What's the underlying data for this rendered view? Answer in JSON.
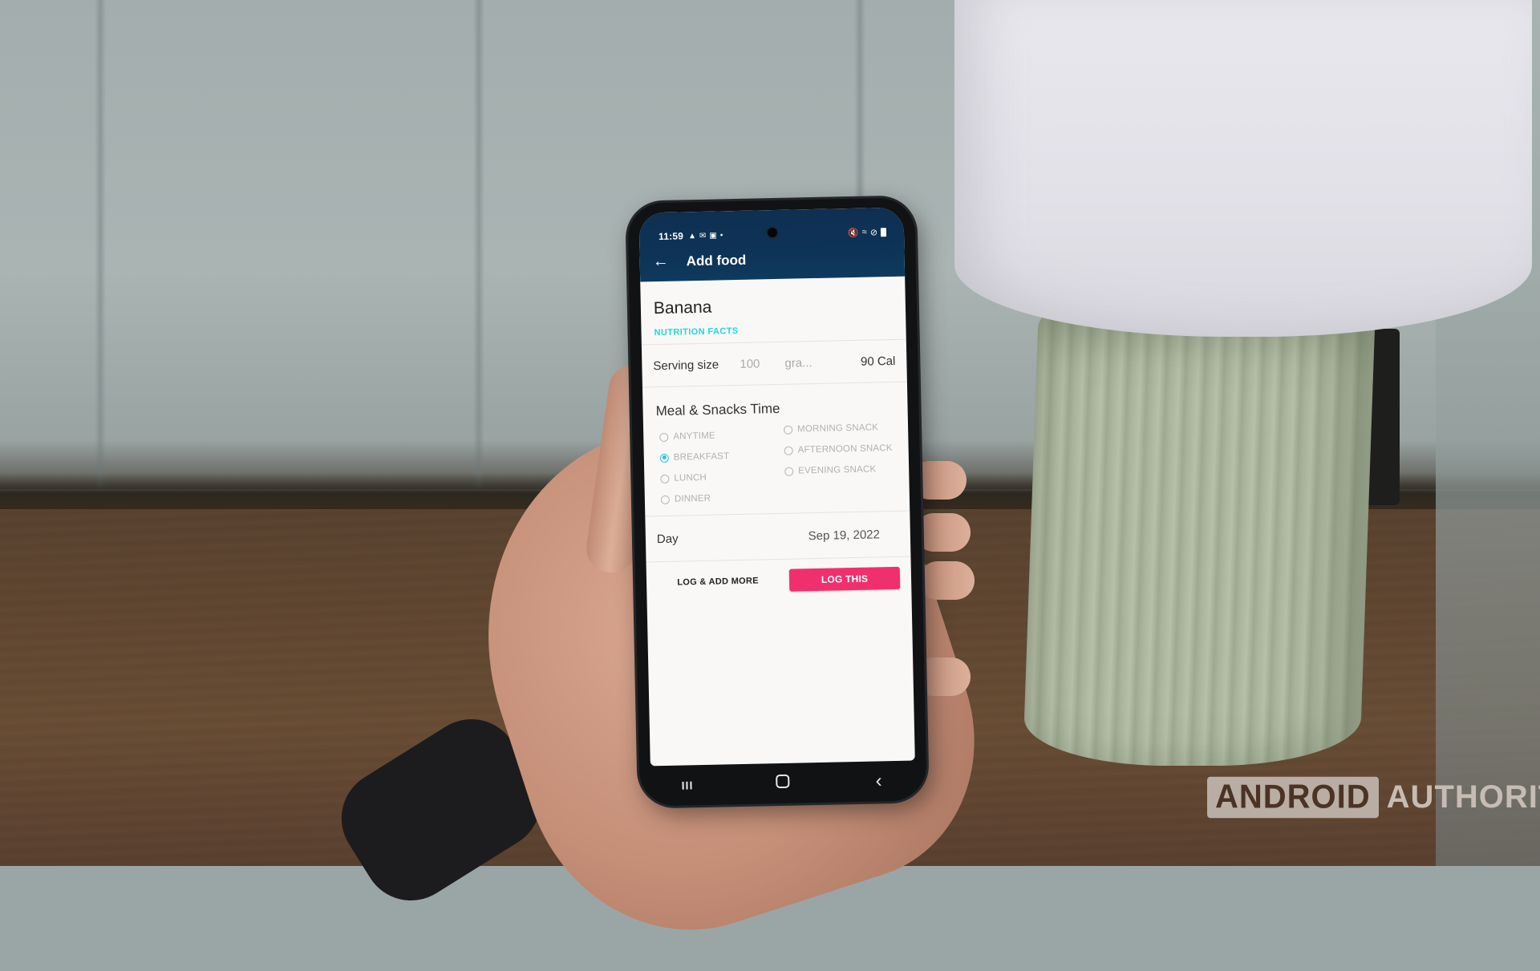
{
  "scene": {
    "description": "Hand holding an Android phone in front of a wall, table and lamp",
    "watermark": {
      "boxed": "ANDROID",
      "plain": "AUTHORITY"
    }
  },
  "status_bar": {
    "time": "11:59",
    "left_icons": [
      "snapchat-icon",
      "gmail-icon",
      "gallery-icon",
      "dot-icon"
    ],
    "right_icons": [
      "mute-icon",
      "wifi-icon",
      "do-not-disturb-icon",
      "battery-icon"
    ]
  },
  "app_bar": {
    "back_icon": "arrow-left-icon",
    "title": "Add food",
    "color": "#0e3256"
  },
  "food": {
    "name": "Banana",
    "section_label": "NUTRITION FACTS",
    "serving": {
      "label": "Serving size",
      "quantity": "100",
      "unit": "gra...",
      "calories": "90 Cal"
    }
  },
  "meal_time": {
    "title": "Meal & Snacks Time",
    "selected": "BREAKFAST",
    "left_options": [
      "ANYTIME",
      "BREAKFAST",
      "LUNCH",
      "DINNER"
    ],
    "right_options": [
      "MORNING SNACK",
      "AFTERNOON SNACK",
      "EVENING SNACK"
    ],
    "accent_color": "#1fc7e0"
  },
  "day": {
    "label": "Day",
    "value": "Sep 19, 2022"
  },
  "actions": {
    "secondary": "LOG & ADD MORE",
    "primary": "LOG THIS",
    "primary_color": "#f0306e"
  },
  "nav_bar": {
    "recents": "III",
    "home": "home-icon",
    "back": "‹"
  }
}
